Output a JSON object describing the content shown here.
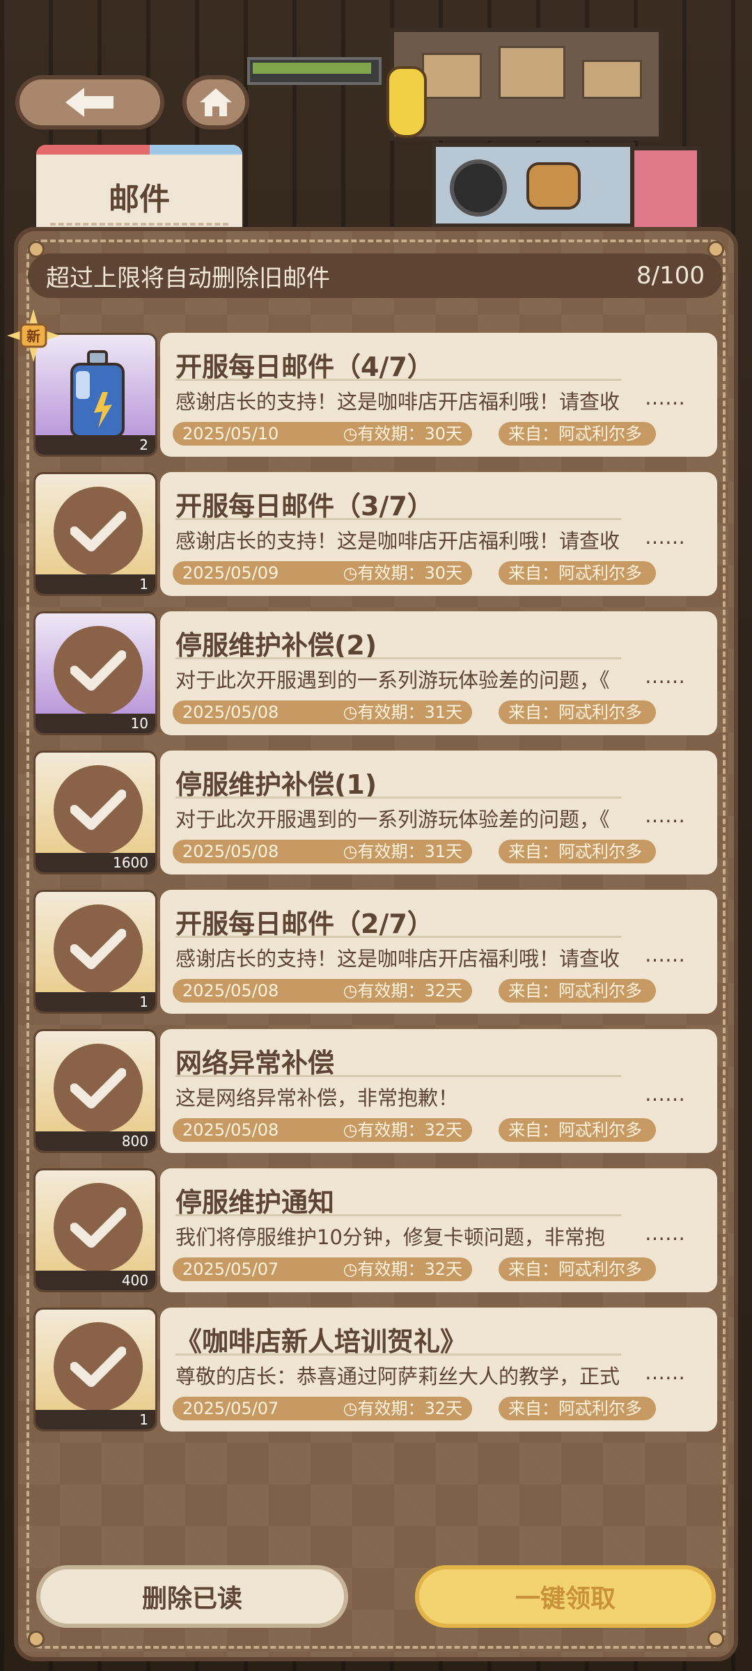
{
  "header": {
    "tab_label": "邮件"
  },
  "notice": {
    "text": "超过上限将自动删除旧邮件",
    "count": "8/100"
  },
  "new_badge": "新",
  "mails": [
    {
      "title": "开服每日邮件（4/7）",
      "desc": "感谢店长的支持！这是咖啡店开店福利哦！请查收",
      "more": "……",
      "date": "2025/05/10",
      "validity": "有效期：30天",
      "from": "来自：阿忒利尔多",
      "qty": "2",
      "claimed": false
    },
    {
      "title": "开服每日邮件（3/7）",
      "desc": "感谢店长的支持！这是咖啡店开店福利哦！请查收",
      "more": "……",
      "date": "2025/05/09",
      "validity": "有效期：30天",
      "from": "来自：阿忒利尔多",
      "qty": "1",
      "claimed": true
    },
    {
      "title": "停服维护补偿(2)",
      "desc": "对于此次开服遇到的一系列游玩体验差的问题，《",
      "more": "……",
      "date": "2025/05/08",
      "validity": "有效期：31天",
      "from": "来自：阿忒利尔多",
      "qty": "10",
      "claimed": true
    },
    {
      "title": "停服维护补偿(1)",
      "desc": "对于此次开服遇到的一系列游玩体验差的问题，《",
      "more": "……",
      "date": "2025/05/08",
      "validity": "有效期：31天",
      "from": "来自：阿忒利尔多",
      "qty": "1600",
      "claimed": true
    },
    {
      "title": "开服每日邮件（2/7）",
      "desc": "感谢店长的支持！这是咖啡店开店福利哦！请查收",
      "more": "……",
      "date": "2025/05/08",
      "validity": "有效期：32天",
      "from": "来自：阿忒利尔多",
      "qty": "1",
      "claimed": true
    },
    {
      "title": "网络异常补偿",
      "desc": "这是网络异常补偿，非常抱歉！",
      "more": "……",
      "date": "2025/05/08",
      "validity": "有效期：32天",
      "from": "来自：阿忒利尔多",
      "qty": "800",
      "claimed": true
    },
    {
      "title": "停服维护通知",
      "desc": "我们将停服维护10分钟，修复卡顿问题，非常抱",
      "more": "……",
      "date": "2025/05/07",
      "validity": "有效期：32天",
      "from": "来自：阿忒利尔多",
      "qty": "400",
      "claimed": true
    },
    {
      "title": "《咖啡店新人培训贺礼》",
      "desc": "尊敬的店长：恭喜通过阿萨莉丝大人的教学，正式",
      "more": "……",
      "date": "2025/05/07",
      "validity": "有效期：32天",
      "from": "来自：阿忒利尔多",
      "qty": "1",
      "claimed": true
    }
  ],
  "buttons": {
    "delete_read": "删除已读",
    "claim_all": "一键领取"
  },
  "colors": {
    "panel": "#7e6148",
    "card": "#efe5d2",
    "accent": "#c69a62",
    "claim_button": "#f3d270"
  }
}
